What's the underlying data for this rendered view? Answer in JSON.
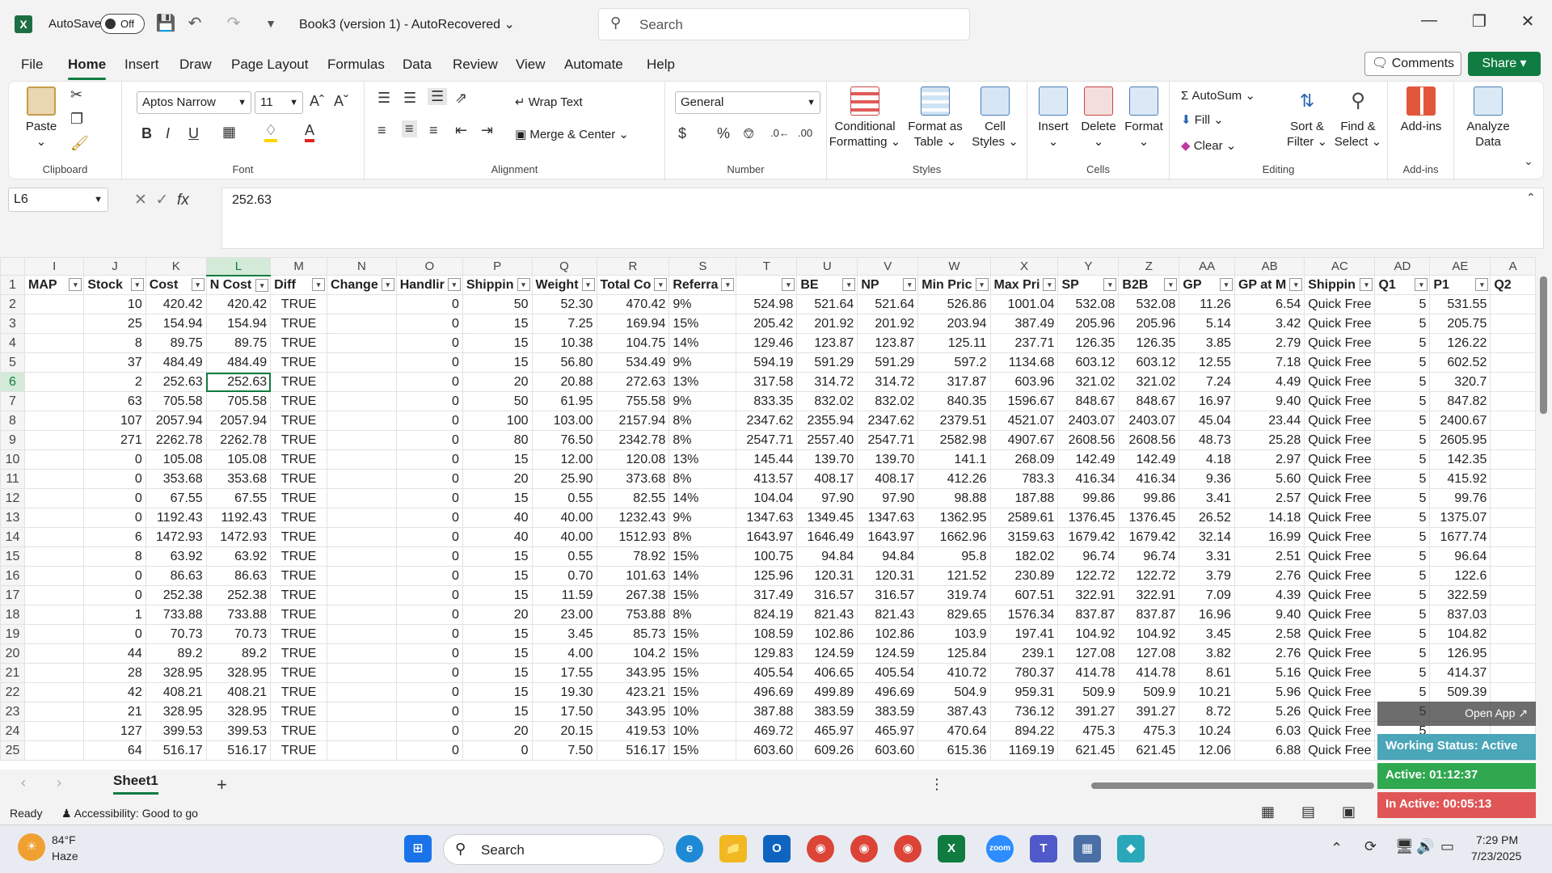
{
  "titlebar": {
    "autosave_label": "AutoSave",
    "toggle_state": "Off",
    "doc_title": "Book3 (version 1)  -  AutoRecovered",
    "search_placeholder": "Search"
  },
  "menu": {
    "tabs": [
      "File",
      "Home",
      "Insert",
      "Draw",
      "Page Layout",
      "Formulas",
      "Data",
      "Review",
      "View",
      "Automate",
      "Help"
    ],
    "active": "Home",
    "comments": "Comments",
    "share": "Share"
  },
  "ribbon": {
    "clipboard": {
      "paste": "Paste",
      "label": "Clipboard"
    },
    "font": {
      "name": "Aptos Narrow",
      "size": "11",
      "label": "Font"
    },
    "alignment": {
      "wrap": "Wrap Text",
      "merge": "Merge & Center",
      "label": "Alignment"
    },
    "number": {
      "format": "General",
      "label": "Number"
    },
    "styles": {
      "cond1": "Conditional",
      "cond2": "Formatting",
      "fmt1": "Format as",
      "fmt2": "Table",
      "cell1": "Cell",
      "cell2": "Styles",
      "label": "Styles"
    },
    "cells": {
      "insert": "Insert",
      "delete": "Delete",
      "format": "Format",
      "label": "Cells"
    },
    "editing": {
      "autosum": "AutoSum",
      "fill": "Fill",
      "clear": "Clear",
      "sort1": "Sort &",
      "sort2": "Filter",
      "find1": "Find &",
      "find2": "Select",
      "label": "Editing"
    },
    "addins": {
      "addins": "Add-ins",
      "label": "Add-ins"
    },
    "analyze": {
      "line1": "Analyze",
      "line2": "Data"
    }
  },
  "formula_bar": {
    "name_box": "L6",
    "value": "252.63"
  },
  "grid": {
    "columns": [
      "I",
      "J",
      "K",
      "L",
      "M",
      "N",
      "O",
      "P",
      "Q",
      "R",
      "S",
      "T",
      "U",
      "V",
      "W",
      "X",
      "Y",
      "Z",
      "AA",
      "AB",
      "AC",
      "AD",
      "AE",
      "A"
    ],
    "headers": [
      "MAP",
      "Stock",
      "Cost",
      "N Cost",
      "Diff",
      "Change",
      "Handlir",
      "Shippin",
      "Weight",
      "Total Co",
      "Referra",
      "",
      "BE",
      "NP",
      "Min Pric",
      "Max Pri",
      "SP",
      "B2B",
      "GP",
      "GP at M",
      "Shippin",
      "Q1",
      "P1",
      "Q2"
    ],
    "rows": [
      [
        "2",
        "",
        "10",
        "420.42",
        "420.42",
        "TRUE",
        "",
        "0",
        "50",
        "52.30",
        "470.42",
        "9%",
        "524.98",
        "521.64",
        "521.64",
        "526.86",
        "1001.04",
        "532.08",
        "532.08",
        "11.26",
        "6.54",
        "Quick Free",
        "5",
        "531.55"
      ],
      [
        "3",
        "",
        "25",
        "154.94",
        "154.94",
        "TRUE",
        "",
        "0",
        "15",
        "7.25",
        "169.94",
        "15%",
        "205.42",
        "201.92",
        "201.92",
        "203.94",
        "387.49",
        "205.96",
        "205.96",
        "5.14",
        "3.42",
        "Quick Free",
        "5",
        "205.75"
      ],
      [
        "4",
        "",
        "8",
        "89.75",
        "89.75",
        "TRUE",
        "",
        "0",
        "15",
        "10.38",
        "104.75",
        "14%",
        "129.46",
        "123.87",
        "123.87",
        "125.11",
        "237.71",
        "126.35",
        "126.35",
        "3.85",
        "2.79",
        "Quick Free",
        "5",
        "126.22"
      ],
      [
        "5",
        "",
        "37",
        "484.49",
        "484.49",
        "TRUE",
        "",
        "0",
        "15",
        "56.80",
        "534.49",
        "9%",
        "594.19",
        "591.29",
        "591.29",
        "597.2",
        "1134.68",
        "603.12",
        "603.12",
        "12.55",
        "7.18",
        "Quick Free",
        "5",
        "602.52"
      ],
      [
        "6",
        "",
        "2",
        "252.63",
        "252.63",
        "TRUE",
        "",
        "0",
        "20",
        "20.88",
        "272.63",
        "13%",
        "317.58",
        "314.72",
        "314.72",
        "317.87",
        "603.96",
        "321.02",
        "321.02",
        "7.24",
        "4.49",
        "Quick Free",
        "5",
        "320.7"
      ],
      [
        "7",
        "",
        "63",
        "705.58",
        "705.58",
        "TRUE",
        "",
        "0",
        "50",
        "61.95",
        "755.58",
        "9%",
        "833.35",
        "832.02",
        "832.02",
        "840.35",
        "1596.67",
        "848.67",
        "848.67",
        "16.97",
        "9.40",
        "Quick Free",
        "5",
        "847.82"
      ],
      [
        "8",
        "",
        "107",
        "2057.94",
        "2057.94",
        "TRUE",
        "",
        "0",
        "100",
        "103.00",
        "2157.94",
        "8%",
        "2347.62",
        "2355.94",
        "2347.62",
        "2379.51",
        "4521.07",
        "2403.07",
        "2403.07",
        "45.04",
        "23.44",
        "Quick Free",
        "5",
        "2400.67"
      ],
      [
        "9",
        "",
        "271",
        "2262.78",
        "2262.78",
        "TRUE",
        "",
        "0",
        "80",
        "76.50",
        "2342.78",
        "8%",
        "2547.71",
        "2557.40",
        "2547.71",
        "2582.98",
        "4907.67",
        "2608.56",
        "2608.56",
        "48.73",
        "25.28",
        "Quick Free",
        "5",
        "2605.95"
      ],
      [
        "10",
        "",
        "0",
        "105.08",
        "105.08",
        "TRUE",
        "",
        "0",
        "15",
        "12.00",
        "120.08",
        "13%",
        "145.44",
        "139.70",
        "139.70",
        "141.1",
        "268.09",
        "142.49",
        "142.49",
        "4.18",
        "2.97",
        "Quick Free",
        "5",
        "142.35"
      ],
      [
        "11",
        "",
        "0",
        "353.68",
        "353.68",
        "TRUE",
        "",
        "0",
        "20",
        "25.90",
        "373.68",
        "8%",
        "413.57",
        "408.17",
        "408.17",
        "412.26",
        "783.3",
        "416.34",
        "416.34",
        "9.36",
        "5.60",
        "Quick Free",
        "5",
        "415.92"
      ],
      [
        "12",
        "",
        "0",
        "67.55",
        "67.55",
        "TRUE",
        "",
        "0",
        "15",
        "0.55",
        "82.55",
        "14%",
        "104.04",
        "97.90",
        "97.90",
        "98.88",
        "187.88",
        "99.86",
        "99.86",
        "3.41",
        "2.57",
        "Quick Free",
        "5",
        "99.76"
      ],
      [
        "13",
        "",
        "0",
        "1192.43",
        "1192.43",
        "TRUE",
        "",
        "0",
        "40",
        "40.00",
        "1232.43",
        "9%",
        "1347.63",
        "1349.45",
        "1347.63",
        "1362.95",
        "2589.61",
        "1376.45",
        "1376.45",
        "26.52",
        "14.18",
        "Quick Free",
        "5",
        "1375.07"
      ],
      [
        "14",
        "",
        "6",
        "1472.93",
        "1472.93",
        "TRUE",
        "",
        "0",
        "40",
        "40.00",
        "1512.93",
        "8%",
        "1643.97",
        "1646.49",
        "1643.97",
        "1662.96",
        "3159.63",
        "1679.42",
        "1679.42",
        "32.14",
        "16.99",
        "Quick Free",
        "5",
        "1677.74"
      ],
      [
        "15",
        "",
        "8",
        "63.92",
        "63.92",
        "TRUE",
        "",
        "0",
        "15",
        "0.55",
        "78.92",
        "15%",
        "100.75",
        "94.84",
        "94.84",
        "95.8",
        "182.02",
        "96.74",
        "96.74",
        "3.31",
        "2.51",
        "Quick Free",
        "5",
        "96.64"
      ],
      [
        "16",
        "",
        "0",
        "86.63",
        "86.63",
        "TRUE",
        "",
        "0",
        "15",
        "0.70",
        "101.63",
        "14%",
        "125.96",
        "120.31",
        "120.31",
        "121.52",
        "230.89",
        "122.72",
        "122.72",
        "3.79",
        "2.76",
        "Quick Free",
        "5",
        "122.6"
      ],
      [
        "17",
        "",
        "0",
        "252.38",
        "252.38",
        "TRUE",
        "",
        "0",
        "15",
        "11.59",
        "267.38",
        "15%",
        "317.49",
        "316.57",
        "316.57",
        "319.74",
        "607.51",
        "322.91",
        "322.91",
        "7.09",
        "4.39",
        "Quick Free",
        "5",
        "322.59"
      ],
      [
        "18",
        "",
        "1",
        "733.88",
        "733.88",
        "TRUE",
        "",
        "0",
        "20",
        "23.00",
        "753.88",
        "8%",
        "824.19",
        "821.43",
        "821.43",
        "829.65",
        "1576.34",
        "837.87",
        "837.87",
        "16.96",
        "9.40",
        "Quick Free",
        "5",
        "837.03"
      ],
      [
        "19",
        "",
        "0",
        "70.73",
        "70.73",
        "TRUE",
        "",
        "0",
        "15",
        "3.45",
        "85.73",
        "15%",
        "108.59",
        "102.86",
        "102.86",
        "103.9",
        "197.41",
        "104.92",
        "104.92",
        "3.45",
        "2.58",
        "Quick Free",
        "5",
        "104.82"
      ],
      [
        "20",
        "",
        "44",
        "89.2",
        "89.2",
        "TRUE",
        "",
        "0",
        "15",
        "4.00",
        "104.2",
        "15%",
        "129.83",
        "124.59",
        "124.59",
        "125.84",
        "239.1",
        "127.08",
        "127.08",
        "3.82",
        "2.76",
        "Quick Free",
        "5",
        "126.95"
      ],
      [
        "21",
        "",
        "28",
        "328.95",
        "328.95",
        "TRUE",
        "",
        "0",
        "15",
        "17.55",
        "343.95",
        "15%",
        "405.54",
        "406.65",
        "405.54",
        "410.72",
        "780.37",
        "414.78",
        "414.78",
        "8.61",
        "5.16",
        "Quick Free",
        "5",
        "414.37"
      ],
      [
        "22",
        "",
        "42",
        "408.21",
        "408.21",
        "TRUE",
        "",
        "0",
        "15",
        "19.30",
        "423.21",
        "15%",
        "496.69",
        "499.89",
        "496.69",
        "504.9",
        "959.31",
        "509.9",
        "509.9",
        "10.21",
        "5.96",
        "Quick Free",
        "5",
        "509.39"
      ],
      [
        "23",
        "",
        "21",
        "328.95",
        "328.95",
        "TRUE",
        "",
        "0",
        "15",
        "17.50",
        "343.95",
        "10%",
        "387.88",
        "383.59",
        "383.59",
        "387.43",
        "736.12",
        "391.27",
        "391.27",
        "8.72",
        "5.26",
        "Quick Free",
        "5",
        ""
      ],
      [
        "24",
        "",
        "127",
        "399.53",
        "399.53",
        "TRUE",
        "",
        "0",
        "20",
        "20.15",
        "419.53",
        "10%",
        "469.72",
        "465.97",
        "465.97",
        "470.64",
        "894.22",
        "475.3",
        "475.3",
        "10.24",
        "6.03",
        "Quick Free",
        "5",
        ""
      ],
      [
        "25",
        "",
        "64",
        "516.17",
        "516.17",
        "TRUE",
        "",
        "0",
        "0",
        "7.50",
        "516.17",
        "15%",
        "603.60",
        "609.26",
        "603.60",
        "615.36",
        "1169.19",
        "621.45",
        "621.45",
        "12.06",
        "6.88",
        "Quick Free",
        "5",
        ""
      ]
    ],
    "selected_cell": "L6"
  },
  "sheet_tab": "Sheet1",
  "status": {
    "ready": "Ready",
    "accessibility": "Accessibility: Good to go"
  },
  "widget": {
    "open_app": "Open App ↗",
    "working": "Working Status: Active",
    "active": "Active: 01:12:37",
    "inactive": "In Active: 00:05:13"
  },
  "taskbar": {
    "weather_temp": "84°F",
    "weather_desc": "Haze",
    "search": "Search",
    "time": "7:29 PM",
    "date": "7/23/2025"
  },
  "colors": {
    "excel_green": "#107c41",
    "active_green": "#2fa84f",
    "inactive_red": "#e05656",
    "teal": "#4aa6b8"
  }
}
